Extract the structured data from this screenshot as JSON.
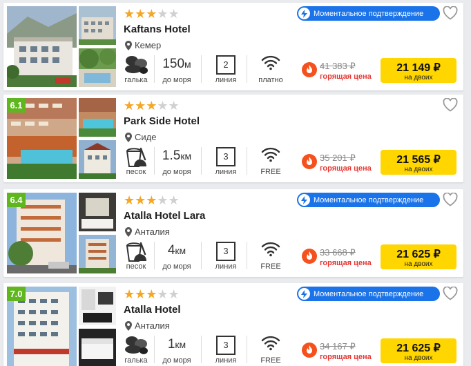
{
  "common": {
    "instant_badge": "Моментальное подтверждение",
    "hot_label": "горящая цена",
    "for_two": "на двоих",
    "sea_label": "до моря",
    "line_label": "линия",
    "star_color": "#f5a623",
    "button_color": "#ffd600",
    "rating_color": "#5fb61f",
    "badge_color": "#1a73e8"
  },
  "hotels": [
    {
      "name": "Kaftans Hotel",
      "city": "Кемер",
      "stars": 3,
      "rating": "",
      "instant": true,
      "beach_icon": "pebbles-icon",
      "beach_label": "галька",
      "distance": "150",
      "distance_unit": "м",
      "line": "2",
      "wifi_label": "платно",
      "old_price": "41 383 ₽",
      "price": "21 149 ₽"
    },
    {
      "name": "Park Side Hotel",
      "city": "Сиде",
      "stars": 3,
      "rating": "6.1",
      "instant": false,
      "beach_icon": "sand-bucket-icon",
      "beach_label": "песок",
      "distance": "1.5",
      "distance_unit": "км",
      "line": "3",
      "wifi_label": "FREE",
      "old_price": "35 201 ₽",
      "price": "21 565 ₽"
    },
    {
      "name": "Atalla Hotel Lara",
      "city": "Анталия",
      "stars": 3,
      "rating": "6.4",
      "instant": true,
      "beach_icon": "sand-bucket-icon",
      "beach_label": "песок",
      "distance": "4",
      "distance_unit": "км",
      "line": "3",
      "wifi_label": "FREE",
      "old_price": "33 668 ₽",
      "price": "21 625 ₽"
    },
    {
      "name": "Atalla Hotel",
      "city": "Анталия",
      "stars": 3,
      "rating": "7.0",
      "instant": true,
      "beach_icon": "pebbles-icon",
      "beach_label": "галька",
      "distance": "1",
      "distance_unit": "км",
      "line": "3",
      "wifi_label": "FREE",
      "old_price": "34 167 ₽",
      "price": "21 625 ₽"
    }
  ]
}
